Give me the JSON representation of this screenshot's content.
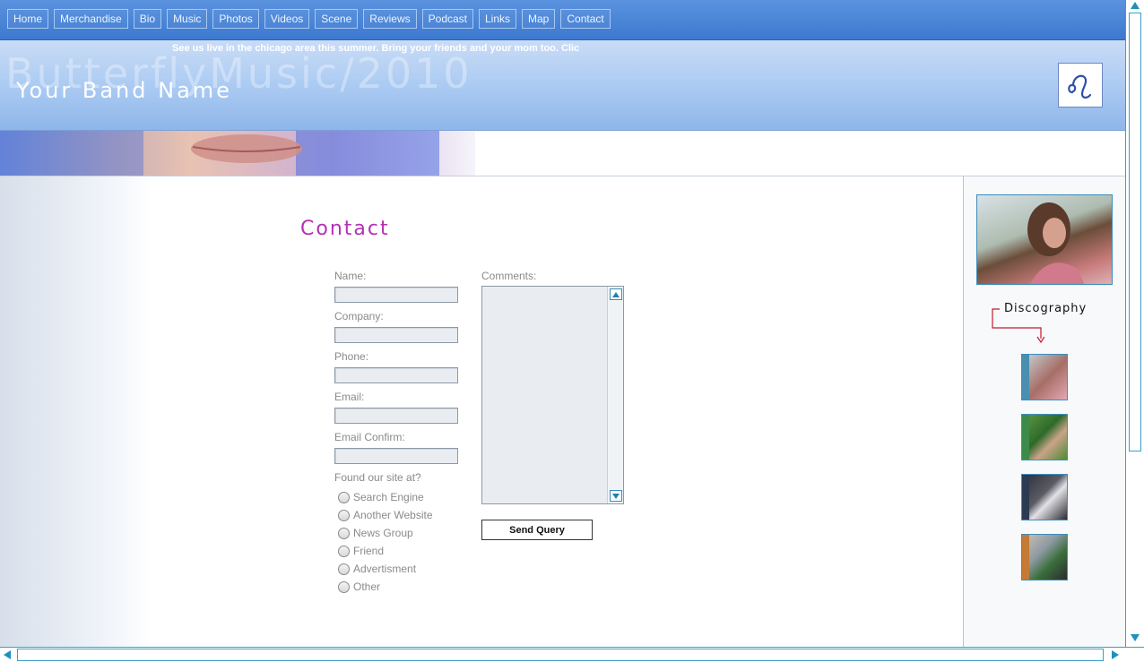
{
  "nav": {
    "items": [
      {
        "label": "Home"
      },
      {
        "label": "Merchandise"
      },
      {
        "label": "Bio"
      },
      {
        "label": "Music"
      },
      {
        "label": "Photos"
      },
      {
        "label": "Videos"
      },
      {
        "label": "Scene"
      },
      {
        "label": "Reviews"
      },
      {
        "label": "Podcast"
      },
      {
        "label": "Links"
      },
      {
        "label": "Map"
      },
      {
        "label": "Contact"
      }
    ]
  },
  "banner": {
    "marquee": "See us live in the chicago area this summer. Bring your friends and your mom too. Clic",
    "watermark": "ButterflyMusic/2010",
    "band_name": "Your Band Name",
    "logo_icon": "leo-zodiac-icon"
  },
  "contact": {
    "title": "Contact",
    "fields": {
      "name": "Name:",
      "company": "Company:",
      "phone": "Phone:",
      "email": "Email:",
      "email_confirm": "Email Confirm:"
    },
    "found_label": "Found our site at?",
    "found_options": [
      "Search Engine",
      "Another Website",
      "News Group",
      "Friend",
      "Advertisment",
      "Other"
    ],
    "comments_label": "Comments:",
    "submit_label": "Send Query"
  },
  "sidebar": {
    "discography_title": "Discography",
    "thumb_colors": [
      "#4a8fb0",
      "#3c8b4a",
      "#2c3b52",
      "#c57a35"
    ]
  },
  "colors": {
    "accent": "#b52fb7",
    "nav_bg": "#4a86d8",
    "scrollbar": "#3aa0c6"
  }
}
